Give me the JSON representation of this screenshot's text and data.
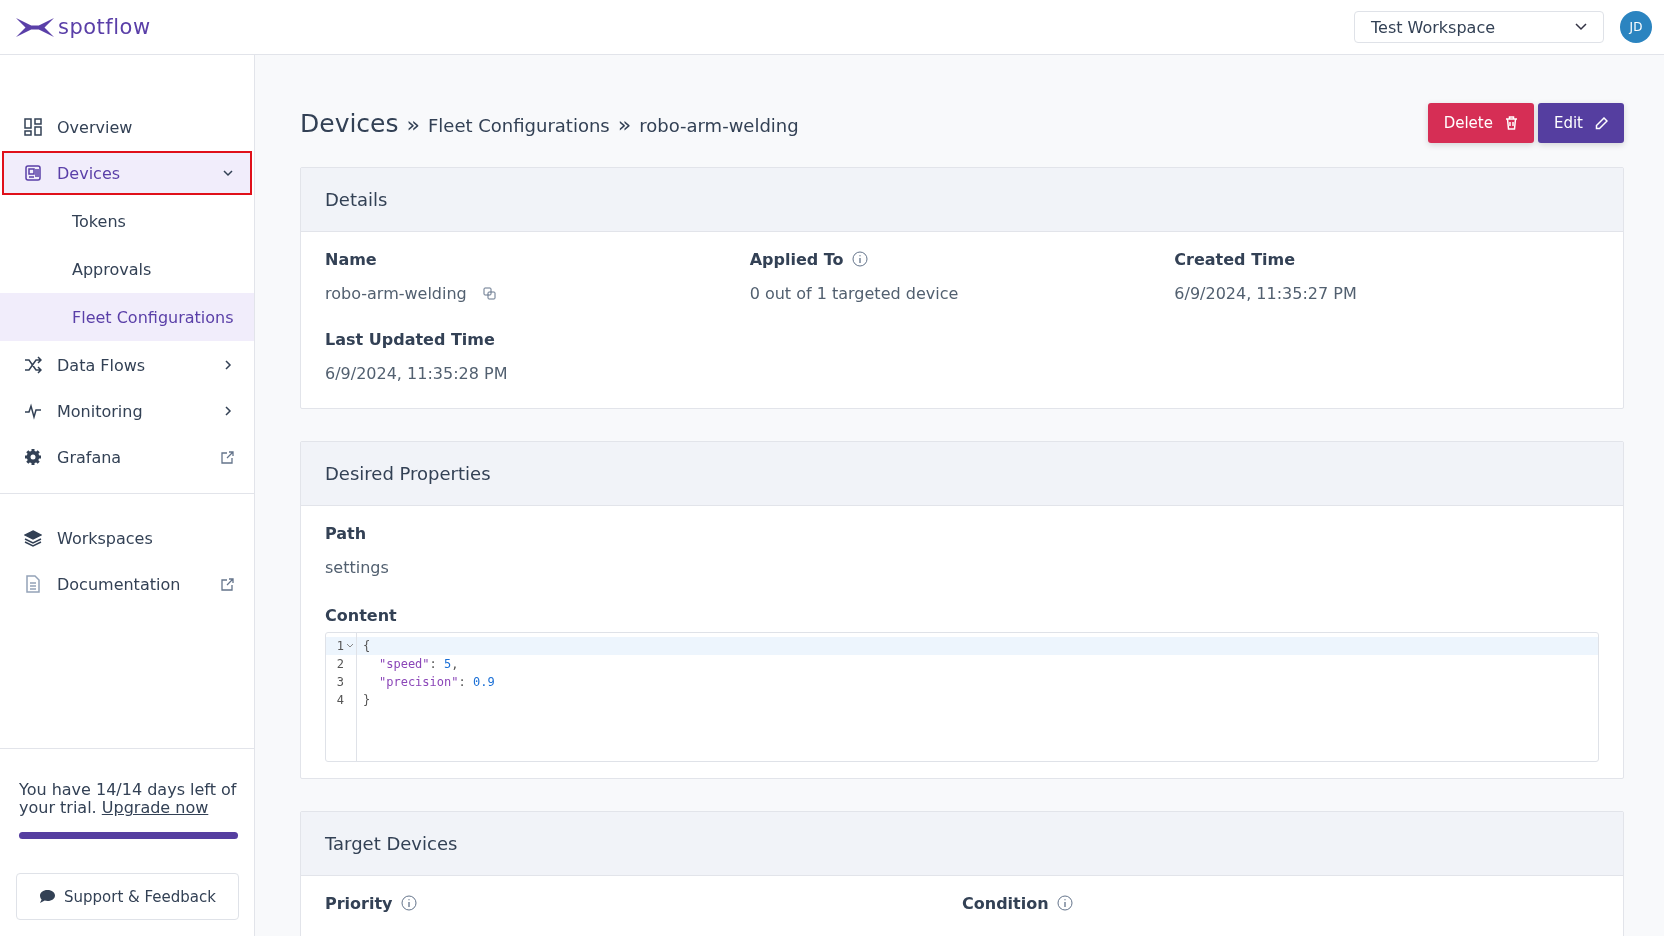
{
  "header": {
    "logo": "spotflow",
    "workspace": "Test Workspace",
    "avatar": "JD"
  },
  "sidebar": {
    "groups": [
      [
        {
          "label": "Overview",
          "kind": "link",
          "selected": false,
          "highlighted": false
        },
        {
          "label": "Devices",
          "kind": "group",
          "expanded": true,
          "selected": true,
          "highlighted": true,
          "children": [
            {
              "label": "Tokens",
              "selected": false
            },
            {
              "label": "Approvals",
              "selected": false
            },
            {
              "label": "Fleet Configurations",
              "selected": true
            }
          ]
        },
        {
          "label": "Data Flows",
          "kind": "group",
          "expanded": false,
          "selected": false,
          "highlighted": false
        },
        {
          "label": "Monitoring",
          "kind": "group",
          "expanded": false,
          "selected": false,
          "highlighted": false
        },
        {
          "label": "Grafana",
          "kind": "external",
          "selected": false,
          "highlighted": false
        }
      ],
      [
        {
          "label": "Workspaces",
          "kind": "link",
          "selected": false,
          "highlighted": false
        },
        {
          "label": "Documentation",
          "kind": "external",
          "selected": false,
          "highlighted": false
        }
      ]
    ],
    "trial": {
      "text": "You have 14/14 days left of your trial.",
      "link": "Upgrade now",
      "level": 1
    },
    "support": "Support & Feedback"
  },
  "page": {
    "title": "Devices",
    "breadcrumbs": [
      "Fleet Configurations",
      "robo-arm-welding"
    ],
    "separator": "»",
    "actions": [
      {
        "label": "Delete",
        "kind": "danger"
      },
      {
        "label": "Edit",
        "kind": "primary"
      }
    ]
  },
  "details": {
    "title": "Details",
    "fields": [
      {
        "label": "Name",
        "value": "robo-arm-welding",
        "info": false,
        "copy": true
      },
      {
        "label": "Applied To",
        "value": "0 out of 1 targeted device",
        "info": true,
        "copy": false
      },
      {
        "label": "Created Time",
        "value": "6/9/2024, 11:35:27 PM",
        "info": false,
        "copy": false
      },
      {
        "label": "Last Updated Time",
        "value": "6/9/2024, 11:35:28 PM",
        "info": false,
        "copy": false
      }
    ]
  },
  "desired_properties": {
    "title": "Desired Properties",
    "path_label": "Path",
    "path": "settings",
    "content_label": "Content",
    "code": [
      {
        "number": "1",
        "fold": true,
        "active": true,
        "tokens": [
          {
            "kind": "punct",
            "text": "{"
          }
        ]
      },
      {
        "number": "2",
        "fold": false,
        "active": false,
        "tokens": [
          {
            "kind": "key",
            "text": "\"speed\""
          },
          {
            "kind": "punct",
            "text": ": "
          },
          {
            "kind": "number",
            "text": "5"
          },
          {
            "kind": "punct",
            "text": ","
          }
        ]
      },
      {
        "number": "3",
        "fold": false,
        "active": false,
        "tokens": [
          {
            "kind": "key",
            "text": "\"precision\""
          },
          {
            "kind": "punct",
            "text": ": "
          },
          {
            "kind": "number",
            "text": "0.9"
          }
        ]
      },
      {
        "number": "4",
        "fold": false,
        "active": false,
        "tokens": [
          {
            "kind": "punct",
            "text": "}"
          }
        ]
      }
    ]
  },
  "target_devices": {
    "title": "Target Devices",
    "fields": [
      {
        "label": "Priority",
        "info": true
      },
      {
        "label": "Condition",
        "info": true
      }
    ]
  }
}
